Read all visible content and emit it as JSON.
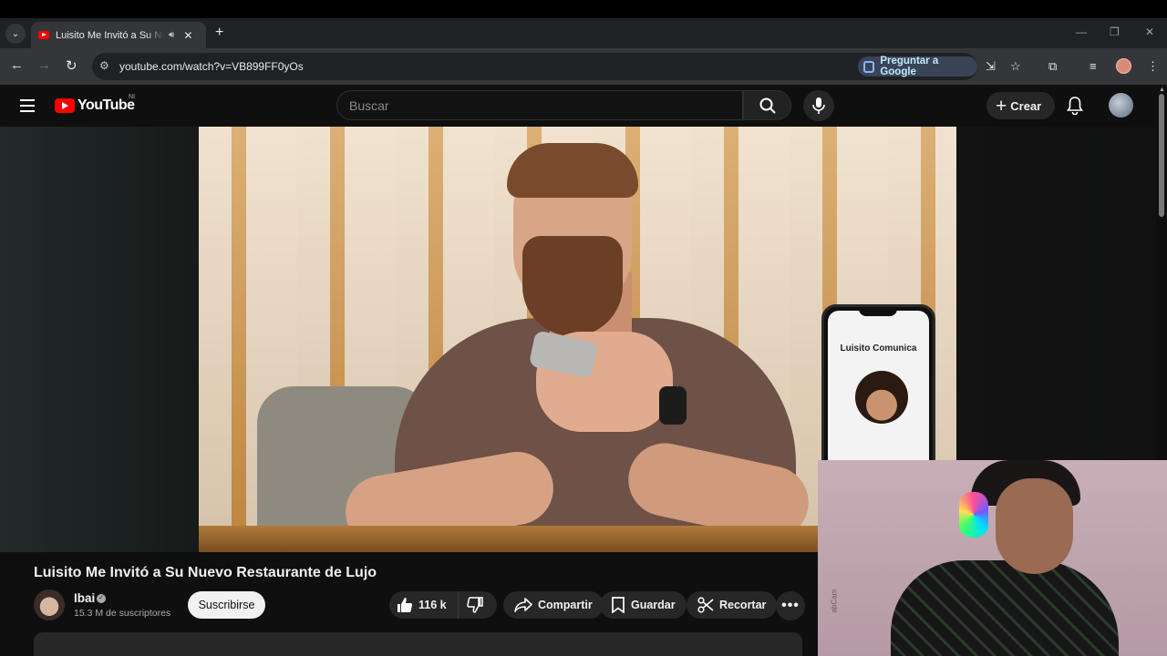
{
  "browser": {
    "tab_title": "Luisito Me Invitó a Su Nuevo Restaurante de Lujo",
    "url": "youtube.com/watch?v=VB899FF0yOs",
    "ask_google_label": "Preguntar a Google"
  },
  "youtube": {
    "logo_text": "YouTube",
    "country_code": "NI",
    "search_placeholder": "Buscar",
    "create_label": "Crear"
  },
  "video": {
    "title": "Luisito Me Invitó a Su Nuevo Restaurante de Lujo",
    "overlay_phone_name": "Luisito Comunica",
    "channel_name": "Ibai",
    "subscribers": "15.3 M de suscriptores",
    "subscribe_label": "Suscribirse",
    "likes": "116 k",
    "share_label": "Compartir",
    "save_label": "Guardar",
    "clip_label": "Recortar"
  },
  "webcam": {
    "watermark": "abCam"
  },
  "colors": {
    "youtube_red": "#ff0000",
    "page_bg": "#0f0f0f",
    "browser_bg": "#202124",
    "toolbar_bg": "#35363a"
  }
}
